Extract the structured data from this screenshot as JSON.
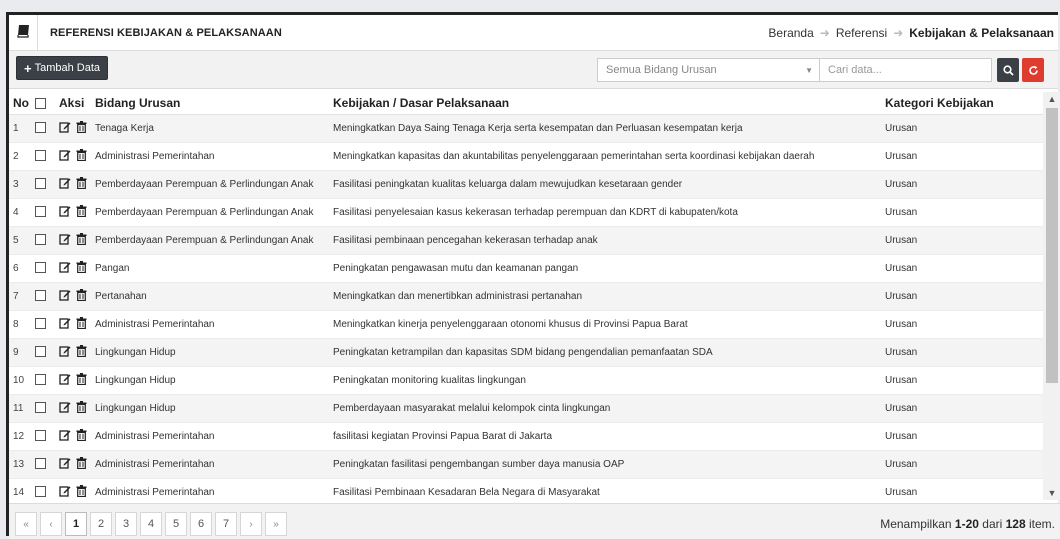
{
  "header": {
    "title": "REFERENSI KEBIJAKAN & PELAKSANAAN",
    "breadcrumb": [
      "Beranda",
      "Referensi",
      "Kebijakan & Pelaksanaan"
    ]
  },
  "toolbar": {
    "add_label": "Tambah Data",
    "bidang_select": "Semua Bidang Urusan",
    "search_placeholder": "Cari data..."
  },
  "table": {
    "columns": [
      "No",
      "",
      "Aksi",
      "Bidang Urusan",
      "Kebijakan / Dasar Pelaksanaan",
      "Kategori Kebijakan"
    ],
    "rows": [
      {
        "no": "1",
        "bidang": "Tenaga Kerja",
        "kebijakan": "Meningkatkan Daya Saing Tenaga Kerja serta kesempatan dan Perluasan kesempatan kerja",
        "kategori": "Urusan"
      },
      {
        "no": "2",
        "bidang": "Administrasi Pemerintahan",
        "kebijakan": "Meningkatkan kapasitas dan akuntabilitas penyelenggaraan pemerintahan serta koordinasi kebijakan daerah",
        "kategori": "Urusan"
      },
      {
        "no": "3",
        "bidang": "Pemberdayaan Perempuan & Perlindungan Anak",
        "kebijakan": "Fasilitasi peningkatan kualitas keluarga dalam mewujudkan kesetaraan gender",
        "kategori": "Urusan"
      },
      {
        "no": "4",
        "bidang": "Pemberdayaan Perempuan & Perlindungan Anak",
        "kebijakan": "Fasilitasi penyelesaian kasus kekerasan terhadap perempuan dan KDRT di kabupaten/kota",
        "kategori": "Urusan"
      },
      {
        "no": "5",
        "bidang": "Pemberdayaan Perempuan & Perlindungan Anak",
        "kebijakan": "Fasilitasi pembinaan pencegahan kekerasan terhadap anak",
        "kategori": "Urusan"
      },
      {
        "no": "6",
        "bidang": "Pangan",
        "kebijakan": "Peningkatan pengawasan mutu dan keamanan pangan",
        "kategori": "Urusan"
      },
      {
        "no": "7",
        "bidang": "Pertanahan",
        "kebijakan": "Meningkatkan dan menertibkan administrasi pertanahan",
        "kategori": "Urusan"
      },
      {
        "no": "8",
        "bidang": "Administrasi Pemerintahan",
        "kebijakan": "Meningkatkan kinerja penyelenggaraan otonomi khusus di Provinsi Papua Barat",
        "kategori": "Urusan"
      },
      {
        "no": "9",
        "bidang": "Lingkungan Hidup",
        "kebijakan": "Peningkatan ketrampilan dan kapasitas SDM bidang pengendalian pemanfaatan SDA",
        "kategori": "Urusan"
      },
      {
        "no": "10",
        "bidang": "Lingkungan Hidup",
        "kebijakan": "Peningkatan monitoring kualitas lingkungan",
        "kategori": "Urusan"
      },
      {
        "no": "11",
        "bidang": "Lingkungan Hidup",
        "kebijakan": "Pemberdayaan masyarakat melalui kelompok cinta lingkungan",
        "kategori": "Urusan"
      },
      {
        "no": "12",
        "bidang": "Administrasi Pemerintahan",
        "kebijakan": "fasilitasi kegiatan Provinsi Papua Barat di Jakarta",
        "kategori": "Urusan"
      },
      {
        "no": "13",
        "bidang": "Administrasi Pemerintahan",
        "kebijakan": "Peningkatan fasilitasi pengembangan sumber daya manusia OAP",
        "kategori": "Urusan"
      },
      {
        "no": "14",
        "bidang": "Administrasi Pemerintahan",
        "kebijakan": "Fasilitasi Pembinaan Kesadaran Bela Negara di Masyarakat",
        "kategori": "Urusan"
      }
    ]
  },
  "pagination": {
    "first": "«",
    "prev": "‹",
    "pages": [
      "1",
      "2",
      "3",
      "4",
      "5",
      "6",
      "7"
    ],
    "active": "1",
    "next": "›",
    "last": "»",
    "summary_prefix": "Menampilkan ",
    "summary_range": "1-20",
    "summary_mid": " dari ",
    "summary_total": "128",
    "summary_suffix": " item."
  },
  "icons": {
    "header": "book-icon",
    "add": "plus-icon",
    "search": "search-icon",
    "refresh": "refresh-icon",
    "edit": "edit-icon",
    "delete": "trash-icon"
  },
  "colors": {
    "dark_button": "#3b4046",
    "refresh_button": "#dd3c2f"
  }
}
